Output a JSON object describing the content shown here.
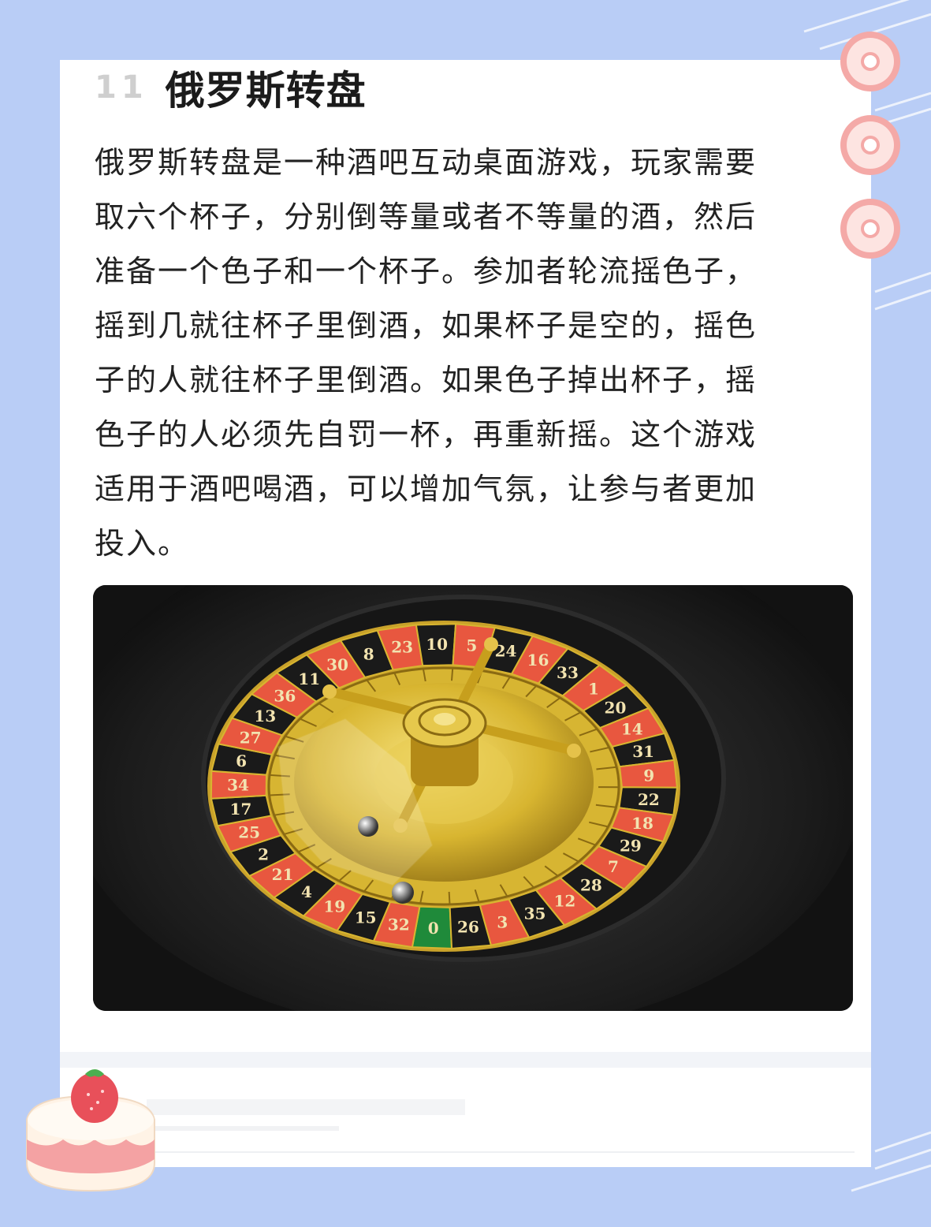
{
  "header": {
    "number": "11",
    "title": "俄罗斯转盘"
  },
  "article": {
    "lines": [
      "俄罗斯转盘是一种酒吧互动桌面游戏，玩家需要",
      "取六个杯子，分别倒等量或者不等量的酒，然后",
      "准备一个色子和一个杯子。参加者轮流摇色子，",
      "摇到几就往杯子里倒酒，如果杯子是空的，摇色",
      "子的人就往杯子里倒酒。如果色子掉出杯子，摇",
      "色子的人必须先自罚一杯，再重新摇。这个游戏",
      "适用于酒吧喝酒，可以增加气氛，让参与者更加",
      "投入。"
    ]
  },
  "photo": {
    "wheel_numbers": [
      "0",
      "32",
      "15",
      "19",
      "4",
      "21",
      "2",
      "25",
      "17",
      "34",
      "6",
      "27",
      "13",
      "36",
      "11",
      "30",
      "8",
      "23",
      "10",
      "5",
      "24",
      "16",
      "33",
      "1",
      "20",
      "14",
      "31",
      "9",
      "22",
      "18",
      "29",
      "7",
      "28",
      "12",
      "35",
      "3",
      "26"
    ],
    "colors": {
      "red": "#e8573f",
      "black": "#1a1a1a",
      "green": "#1f8a3a",
      "gold": "#d8b530"
    }
  },
  "theme": {
    "background": "#b9cdf6",
    "card": "#ffffff",
    "title_highlight": "#ddd6fb"
  }
}
